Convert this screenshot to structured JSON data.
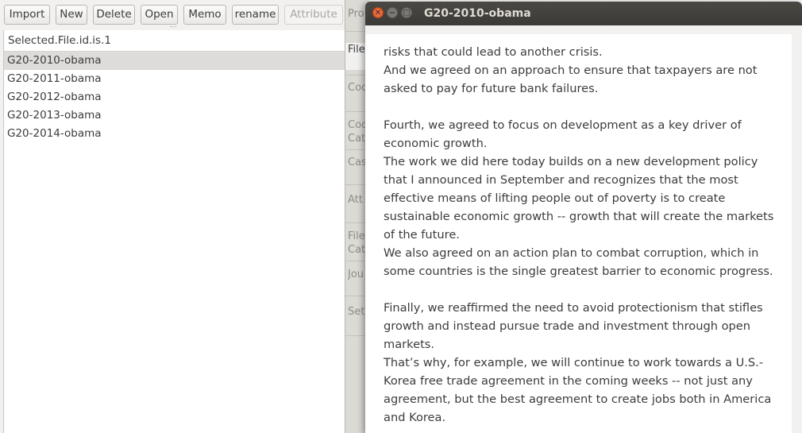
{
  "toolbar": {
    "import": "Import",
    "new": "New",
    "delete": "Delete",
    "open": "Open",
    "memo": "Memo",
    "rename": "rename",
    "attribute": "Attribute"
  },
  "file_list": {
    "header": "Selected.File.id.is.1",
    "items": [
      "G20-2010-obama",
      "G20-2011-obama",
      "G20-2012-obama",
      "G20-2013-obama",
      "G20-2014-obama"
    ],
    "selected_index": 0
  },
  "side_tabs": [
    "Pro",
    "File",
    "Coc",
    "Coc Cat",
    "Cas",
    "Att",
    "File Cat",
    "Jou",
    "Set"
  ],
  "document_window": {
    "title": "G20-2010-obama",
    "close_glyph": "✕",
    "min_glyph": "−",
    "max_glyph": "□",
    "lines": [
      "risks that could lead to another crisis.",
      "And we agreed on an approach to ensure that taxpayers are not",
      "asked to pay for future bank failures.",
      "",
      "Fourth, we agreed to focus on development as a key driver of",
      "economic growth.",
      "The work we did here today builds on a new development policy",
      "that I announced in September and recognizes that the most",
      "effective means of lifting people out of poverty is to create",
      "sustainable economic growth -- growth that will create the markets",
      "of the future.",
      "We also agreed on an action plan to combat corruption, which in",
      "some countries is the single greatest barrier to economic progress.",
      "",
      "Finally, we reaffirmed the need to avoid protectionism that stifles",
      "growth and instead pursue trade and investment through open",
      "markets.",
      "That’s why, for example, we will continue to work towards a U.S.-",
      "Korea free trade agreement in the coming weeks -- not just any",
      "agreement, but the best agreement to create jobs both in America",
      "and Korea."
    ]
  },
  "colors": {
    "window_bg": "#f2f1f0",
    "titlebar": "#3b3a36",
    "close_button": "#e0531f",
    "selected_row": "#dedcda"
  }
}
